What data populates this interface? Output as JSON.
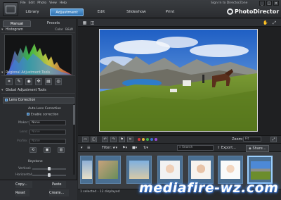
{
  "menu": [
    "File",
    "Edit",
    "Photo",
    "View",
    "Help"
  ],
  "window": {
    "signin": "Sign In to DirectorZone",
    "buttons": [
      "_",
      "□",
      "×"
    ]
  },
  "brand": "PhotoDirector",
  "modes": [
    {
      "label": "Library",
      "active": false
    },
    {
      "label": "Adjustment",
      "active": true
    },
    {
      "label": "Edit",
      "active": false
    },
    {
      "label": "Slideshow",
      "active": false
    },
    {
      "label": "Print",
      "active": false
    }
  ],
  "left_panel": {
    "tabs": [
      {
        "label": "Manual",
        "active": true
      },
      {
        "label": "Presets",
        "active": false
      }
    ],
    "histogram": {
      "label": "Histogram",
      "modes": [
        "Color",
        "B&W"
      ]
    },
    "regional_tools": {
      "label": "Regional Adjustment Tools"
    },
    "global_tools": {
      "label": "Global Adjustment Tools"
    },
    "lens_correction": {
      "label": "Lens Correction",
      "auto_label": "Auto Lens Correction",
      "enable_label": "Enable correction",
      "maker_label": "Maker:",
      "maker_value": "None",
      "lens_label": "Lens:",
      "lens_value": "None",
      "profile_label": "Profile:",
      "profile_value": "None",
      "keystone_label": "Keystone",
      "vertical_label": "Vertical:",
      "horizontal_label": "Horizontal:"
    },
    "buttons": {
      "copy": "Copy...",
      "paste": "Paste",
      "reset": "Reset",
      "create": "Create..."
    }
  },
  "bottom_toolbar": {
    "zoom_label": "Zoom:",
    "zoom_value": "Fit"
  },
  "filter_bar": {
    "filter_label": "Filter:",
    "search_placeholder": "Search",
    "export_label": "Export...",
    "share_label": "Share..."
  },
  "status": {
    "selected": "1 selected - 12 displayed",
    "collection": "Collection / All Photos"
  },
  "colors": {
    "accent": "#2e6fae",
    "label_swatches": [
      "#d23a3a",
      "#e0b43a",
      "#3fae4a",
      "#3a6fd2",
      "#9a4ad2"
    ]
  },
  "watermark": "mediafire-wz.com"
}
